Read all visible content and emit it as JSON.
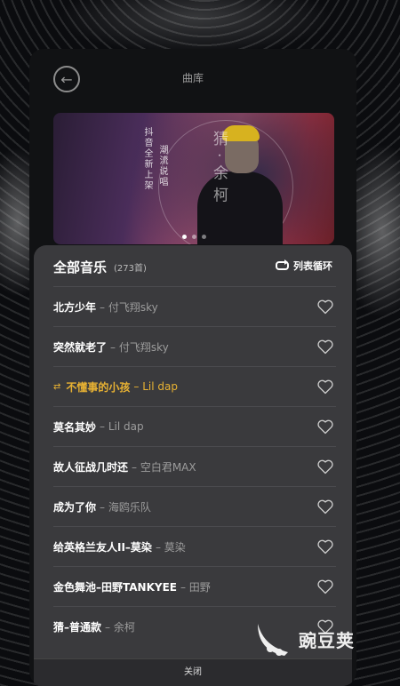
{
  "header": {
    "title": "曲库"
  },
  "banner": {
    "title": "猜·余柯",
    "sub1": "抖音全新上架",
    "sub2": "潮流说唱",
    "dots": 3,
    "active_dot": 0
  },
  "playlist": {
    "title": "全部音乐",
    "count": "(273首)",
    "mode_label": "列表循环",
    "songs": [
      {
        "name": "北方少年",
        "artist": "– 付飞翔sky"
      },
      {
        "name": "突然就老了",
        "artist": "– 付飞翔sky"
      },
      {
        "name": "不懂事的小孩",
        "artist": "– Lil dap",
        "playing": true
      },
      {
        "name": "莫名其妙",
        "artist": "– Lil dap"
      },
      {
        "name": "故人征战几时还",
        "artist": "– 空白君MAX"
      },
      {
        "name": "成为了你",
        "artist": "– 海鸥乐队"
      },
      {
        "name": "给英格兰友人II–莫染",
        "artist": "– 莫染"
      },
      {
        "name": "金色舞池–田野TANKYEE",
        "artist": "– 田野"
      },
      {
        "name": "猜–普通款",
        "artist": "– 余柯"
      }
    ],
    "close_label": "关闭"
  },
  "watermark": {
    "text": "豌豆荚"
  },
  "colors": {
    "accent": "#e8b233",
    "sheet": "#3a3a3d"
  }
}
